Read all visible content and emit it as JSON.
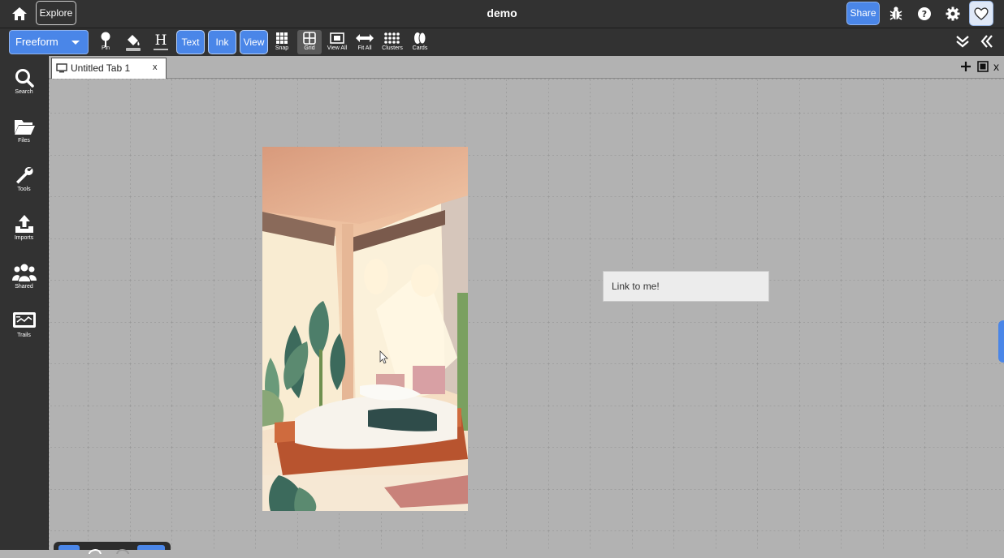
{
  "topbar": {
    "home_icon": "home-icon",
    "explore_label": "Explore",
    "title": "demo",
    "share_label": "Share",
    "bug_icon": "bug-icon",
    "help_icon": "question-circle-icon",
    "settings_icon": "gear-icon",
    "heart_icon": "heart-icon"
  },
  "toolbar": {
    "mode": "Freeform",
    "pin_label": "Pin",
    "text_label": "Text",
    "ink_label": "Ink",
    "view_label": "View",
    "snap_label": "Snap",
    "grid_label": "Grid",
    "view_all_label": "View All",
    "fit_all_label": "Fit All",
    "clusters_label": "Clusters",
    "cards_label": "Cards"
  },
  "sidebar": {
    "items": [
      {
        "label": "Search",
        "icon": "search-icon"
      },
      {
        "label": "Files",
        "icon": "folder-icon"
      },
      {
        "label": "Tools",
        "icon": "wrench-icon"
      },
      {
        "label": "Imports",
        "icon": "upload-icon"
      },
      {
        "label": "Shared",
        "icon": "users-icon"
      },
      {
        "label": "Trails",
        "icon": "presentation-icon"
      }
    ]
  },
  "tabs": [
    {
      "title": "Untitled Tab 1",
      "close": "x"
    }
  ],
  "tab_controls": {
    "add": "+",
    "close": "x"
  },
  "canvas": {
    "note_text": "Link to me!",
    "image_alt": "Illustrated sunlit bedroom with plants"
  },
  "colors": {
    "chrome": "#323232",
    "accent": "#4a86e8",
    "canvas": "#b2b2b2"
  }
}
